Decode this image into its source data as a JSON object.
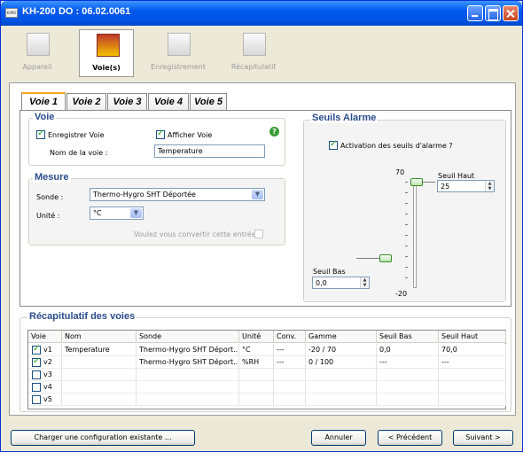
{
  "window": {
    "title": "KH-200 DO : 06.02.0061",
    "app_icon": "kimo-app-icon"
  },
  "wizard": [
    {
      "label": "Appareil",
      "icon": "device-icon",
      "active": false
    },
    {
      "label": "Voie(s)",
      "icon": "channels-icon",
      "active": true
    },
    {
      "label": "Enregistrement",
      "icon": "recording-clock-icon",
      "active": false
    },
    {
      "label": "Récapitulatif",
      "icon": "summary-folder-icon",
      "active": false
    }
  ],
  "tabs": [
    "Voie 1",
    "Voie 2",
    "Voie 3",
    "Voie 4",
    "Voie 5"
  ],
  "voie": {
    "title": "Voie",
    "record_label": "Enregistrer Voie",
    "record_checked": true,
    "display_label": "Afficher Voie",
    "display_checked": true,
    "name_label": "Nom de la voie :",
    "name_value": "Temperature"
  },
  "mesure": {
    "title": "Mesure",
    "sonde_label": "Sonde :",
    "sonde_value": "Thermo-Hygro SHT Déportée",
    "unit_label": "Unité :",
    "unit_value": "°C",
    "convert_label": "Voulez vous convertir cette entrée ?"
  },
  "alarm": {
    "title": "Seuils Alarme",
    "activation_label": "Activation des seuils d'alarme ?",
    "activation_checked": true,
    "max_label": "70",
    "min_label": "-20",
    "high_label": "Seuil Haut",
    "high_value": "25",
    "low_label": "Seuil Bas",
    "low_value": "0,0"
  },
  "recap": {
    "title": "Récapitulatif des voies",
    "columns": [
      "Voie",
      "Nom",
      "Sonde",
      "Unité",
      "Conv.",
      "Gamme",
      "Seuil Bas",
      "Seuil Haut"
    ],
    "rows": [
      {
        "checked": true,
        "cells": [
          "v1",
          "Temperature",
          "Thermo-Hygro SHT Déport...",
          "°C",
          "---",
          "-20 / 70",
          "0,0",
          "70,0"
        ]
      },
      {
        "checked": true,
        "cells": [
          "v2",
          "",
          "Thermo-Hygro SHT Déport...",
          "%RH",
          "---",
          "0 / 100",
          "---",
          "---"
        ]
      },
      {
        "checked": false,
        "cells": [
          "v3",
          "",
          "",
          "",
          "",
          "",
          "",
          ""
        ]
      },
      {
        "checked": false,
        "cells": [
          "v4",
          "",
          "",
          "",
          "",
          "",
          "",
          ""
        ]
      },
      {
        "checked": false,
        "cells": [
          "v5",
          "",
          "",
          "",
          "",
          "",
          "",
          ""
        ]
      }
    ]
  },
  "buttons": {
    "load": "Charger une configuration existante ...",
    "cancel": "Annuler",
    "previous": "< Précédent",
    "next": "Suivant >"
  }
}
